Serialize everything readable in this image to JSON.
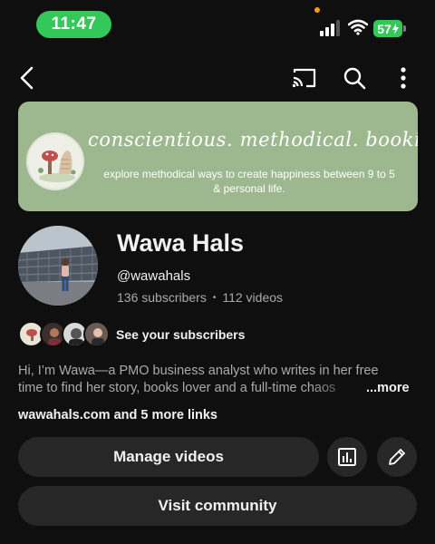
{
  "status_bar": {
    "time": "11:47",
    "battery_level": "57",
    "colors": {
      "time_pill": "#34c759",
      "battery": "#34c759",
      "privacy_dot": "#ff9f0a"
    },
    "icons": [
      "cellular-signal-icon",
      "wifi-icon",
      "battery-charging-icon"
    ]
  },
  "top_nav": {
    "icons": [
      "back-arrow-icon",
      "cast-icon",
      "search-icon",
      "more-vertical-icon"
    ]
  },
  "banner": {
    "tagline": "conscientious. methodical. bookish.",
    "subtitle": "explore methodical ways to create happiness between 9 to 5 & personal life.",
    "background_color": "#9db88f"
  },
  "channel": {
    "name": "Wawa Hals",
    "handle": "@wawahals",
    "subscribers": "136 subscribers",
    "separator": "•",
    "videos": "112 videos"
  },
  "subscribers_row": {
    "label": "See your subscribers"
  },
  "description": {
    "line1": "Hi, I’m Wawa—a PMO business analyst who writes in her free",
    "line2": "time to find her story, books lover and a full-time chaos",
    "more": "...more"
  },
  "links": {
    "text": "wawahals.com and 5 more links"
  },
  "actions": {
    "manage_videos": "Manage videos",
    "visit_community": "Visit community",
    "icons": [
      "analytics-icon",
      "edit-pencil-icon"
    ]
  },
  "theme": {
    "background": "#0f0f0f",
    "button_bg": "#272727",
    "text_primary": "#f1f1f1",
    "text_secondary": "#aaaaaa"
  }
}
